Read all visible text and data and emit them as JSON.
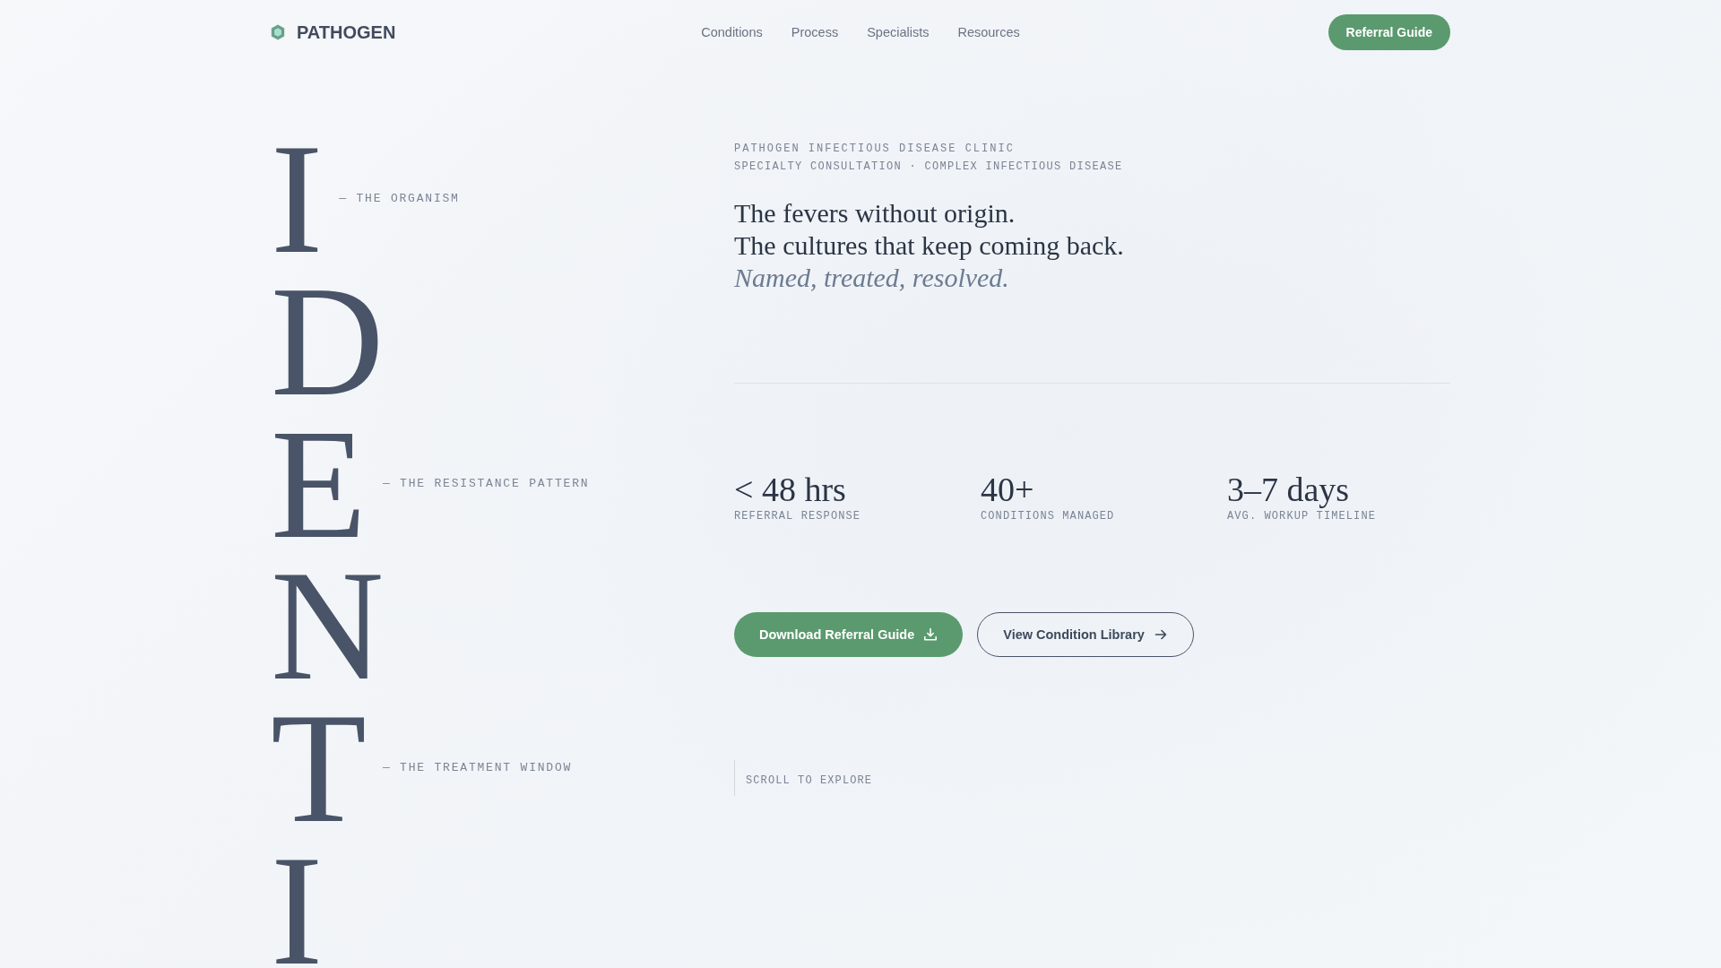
{
  "header": {
    "brand": "PATHOGEN",
    "nav": [
      {
        "label": "Conditions"
      },
      {
        "label": "Process"
      },
      {
        "label": "Specialists"
      },
      {
        "label": "Resources"
      }
    ],
    "cta": "Referral Guide"
  },
  "letters": [
    {
      "letter": "I",
      "label": "— THE ORGANISM"
    },
    {
      "letter": "D"
    },
    {
      "letter": "E",
      "label": "— THE RESISTANCE PATTERN"
    },
    {
      "letter": "N"
    },
    {
      "letter": "T",
      "label": "— THE TREATMENT WINDOW"
    },
    {
      "letter": "I"
    }
  ],
  "eyebrow": {
    "title": "PATHOGEN INFECTIOUS DISEASE CLINIC",
    "subtitle": "SPECIALTY CONSULTATION · COMPLEX INFECTIOUS DISEASE"
  },
  "headline": [
    {
      "kind": "plain",
      "text": "The fevers without origin."
    },
    {
      "kind": "plain",
      "text": "The cultures that keep coming back."
    },
    {
      "kind": "accent",
      "text": "Named, treated, resolved."
    }
  ],
  "stats": [
    {
      "value": "< 48 hrs",
      "label": "REFERRAL RESPONSE"
    },
    {
      "value": "40+",
      "label": "CONDITIONS MANAGED"
    },
    {
      "value": "3–7 days",
      "label": "AVG. WORKUP TIMELINE"
    }
  ],
  "actions": [
    {
      "kind": "primary",
      "label": "Download Referral Guide"
    },
    {
      "kind": "secondary",
      "label": "View Condition Library"
    }
  ],
  "scroll_hint": "SCROLL TO EXPLORE"
}
